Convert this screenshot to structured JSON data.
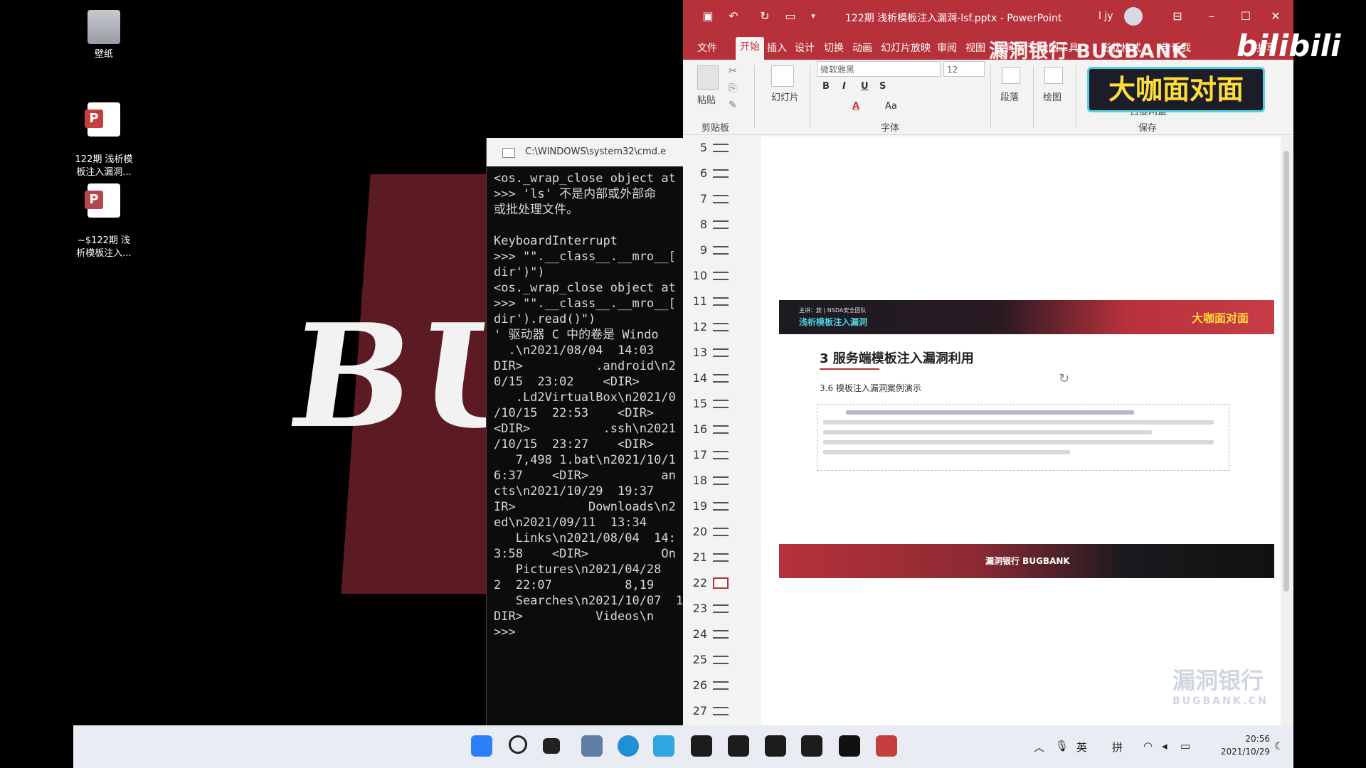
{
  "desktop": {
    "icons": [
      {
        "label": "壁纸"
      },
      {
        "label": "122期 浅析模\n板注入漏洞..."
      },
      {
        "label": "~$122期 浅\n析模板注入..."
      }
    ],
    "wallpaper_text": "BU"
  },
  "cmd": {
    "title": "C:\\WINDOWS\\system32\\cmd.e",
    "lines": [
      "<os._wrap_close object at",
      ">>> 'ls' 不是内部或外部命",
      "或批处理文件。",
      "",
      "KeyboardInterrupt",
      ">>> \"\".__class__.__mro__[",
      "dir')\")",
      "<os._wrap_close object at",
      ">>> \"\".__class__.__mro__[",
      "dir').read()\")",
      "' 驱动器 C 中的卷是 Windo",
      "  .\\n2021/08/04  14:03",
      "DIR>          .android\\n2",
      "0/15  23:02    <DIR>",
      "   .Ld2VirtualBox\\n2021/0",
      "/10/15  22:53    <DIR>",
      "<DIR>          .ssh\\n2021",
      "/10/15  23:27    <DIR>",
      "   7,498 1.bat\\n2021/10/1",
      "6:37    <DIR>          an",
      "cts\\n2021/10/29  19:37",
      "IR>          Downloads\\n2",
      "ed\\n2021/09/11  13:34",
      "   Links\\n2021/08/04  14:",
      "3:58    <DIR>          On",
      "   Pictures\\n2021/04/28",
      "2  22:07          8,19",
      "   Searches\\n2021/10/07  17",
      "DIR>          Videos\\n",
      ">>>"
    ]
  },
  "ppt": {
    "title": "122期 浅析模板注入漏洞-lsf.pptx - PowerPoint",
    "user": "l jy",
    "menu": [
      "文件",
      "开始",
      "插入",
      "设计",
      "切换",
      "动画",
      "幻灯片放映",
      "审阅",
      "视图",
      "漏洞银行",
      "绘图工具",
      "形状格式",
      "告诉我",
      "共享"
    ],
    "active_menu": "开始",
    "ribbon": {
      "paste": "粘贴",
      "clipboard": "剪贴板",
      "slide": "幻灯片",
      "font_name": "微软雅黑",
      "font_size": "12",
      "font_group": "字体",
      "paragraph": "段落",
      "drawing": "绘图",
      "baidu": "百度网盘",
      "save": "保存",
      "fmt_bold": "B",
      "fmt_italic": "I",
      "fmt_underline": "U",
      "fmt_strike": "S",
      "fmt_case": "Aa",
      "fmt_color": "A"
    },
    "slide_numbers": [
      "5",
      "6",
      "7",
      "8",
      "9",
      "10",
      "11",
      "12",
      "13",
      "14",
      "15",
      "16",
      "17",
      "18",
      "19",
      "20",
      "21",
      "22",
      "23",
      "24",
      "25",
      "26",
      "27"
    ],
    "selected_slide": "22",
    "slide": {
      "banner_small": "主讲：旋 | NSDA安全团队",
      "banner_title": "浅析模板注入漏洞",
      "banner_logo": "大咖面对面",
      "heading": "3 服务端模板注入漏洞利用",
      "subheading": "3.6 模板注入漏洞案例演示",
      "footer": "漏洞银行  BUGBANK",
      "watermark": "漏洞银行",
      "watermark_sub": "BUGBANK.CN"
    }
  },
  "taskbar": {
    "tray_lang": "英",
    "tray_ime": "拼",
    "time": "20:56",
    "date": "2021/10/29"
  },
  "overlays": {
    "bugbank_banner": "漏洞银行 BUGBANK",
    "bilibili": "bilibili",
    "face_logo": "大咖面对面"
  },
  "colors": {
    "ppt_accent": "#b7313b",
    "taskbar": "#e9ecf2",
    "face_logo_text": "#ffde3a"
  }
}
